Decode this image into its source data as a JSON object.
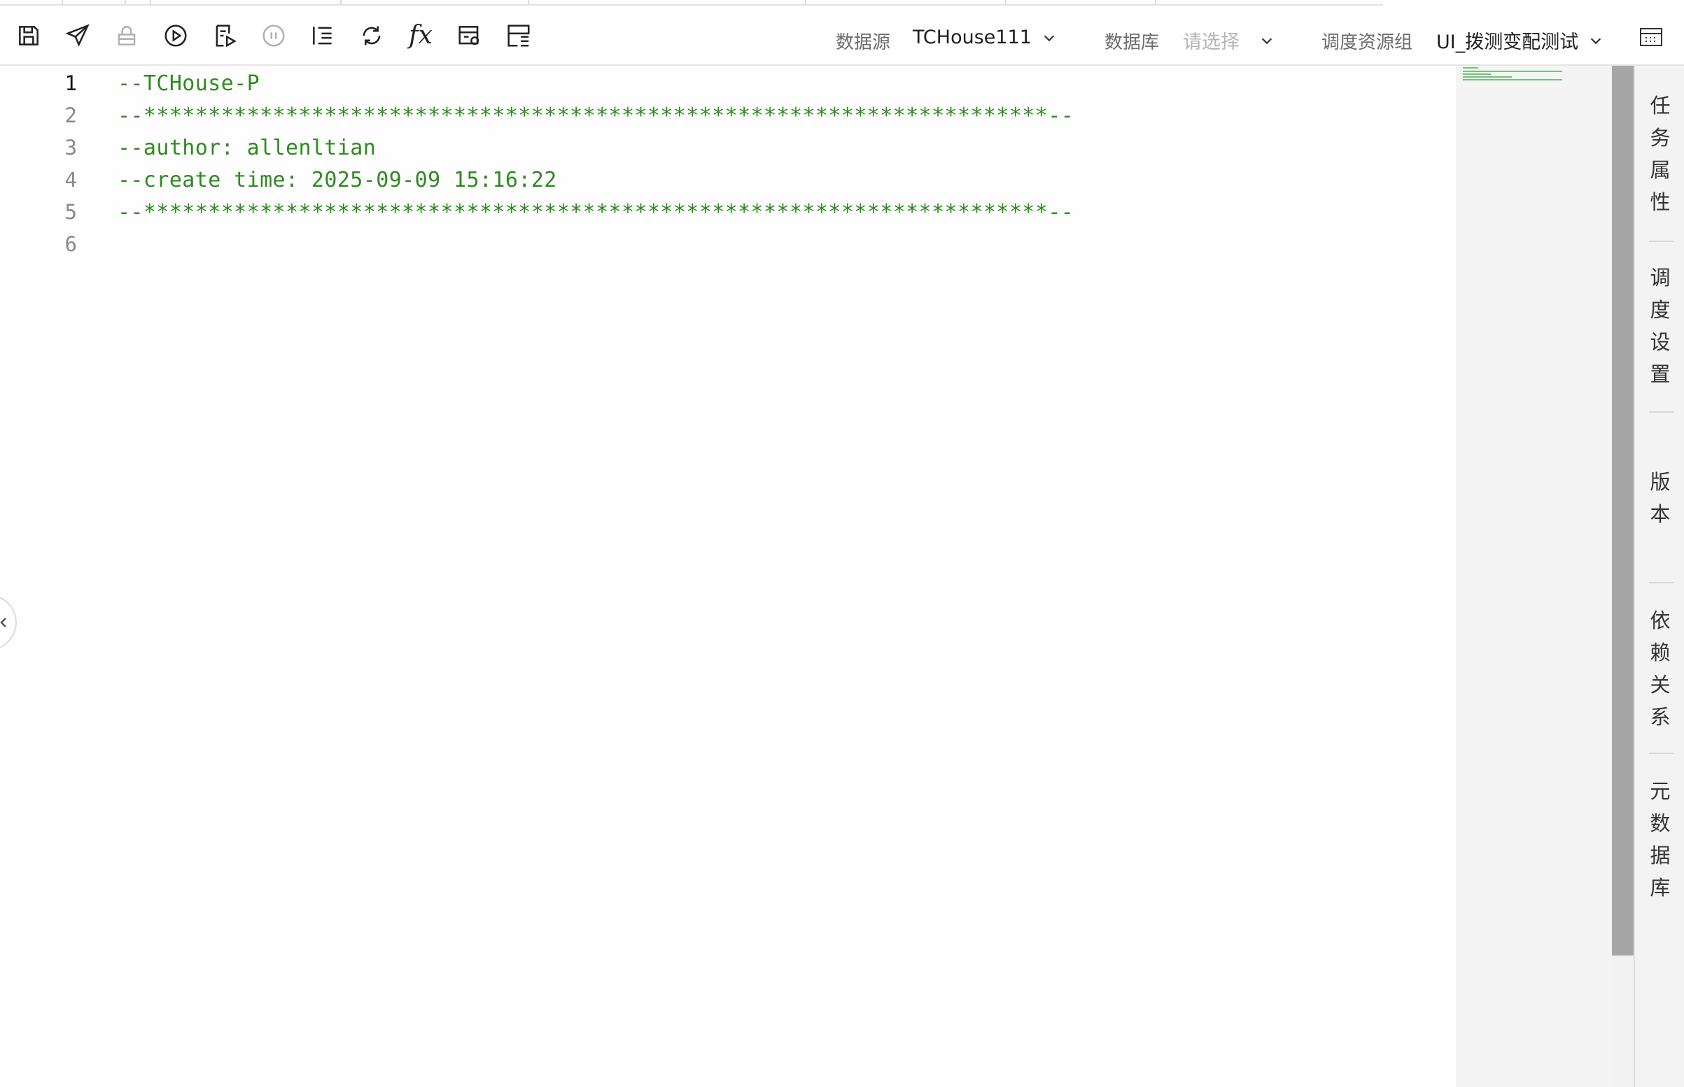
{
  "toolbar": {
    "icons": [
      "save-icon",
      "submit-icon",
      "lock-icon",
      "run-icon",
      "run-selected-icon",
      "stop-icon",
      "format-icon",
      "refresh-icon",
      "function-icon",
      "params-icon",
      "table-icon"
    ],
    "datasource_label": "数据源",
    "datasource_value": "TCHouse111",
    "database_label": "数据库",
    "database_placeholder": "请选择",
    "resource_group_label": "调度资源组",
    "resource_group_value": "UI_拨测变配测试"
  },
  "editor": {
    "active_line": 1,
    "lines": [
      {
        "number": "1",
        "text": "--TCHouse-P"
      },
      {
        "number": "2",
        "text": "--**********************************************************************--"
      },
      {
        "number": "3",
        "text": "--author: allenltian"
      },
      {
        "number": "4",
        "text": "--create time: 2025-09-09 15:16:22"
      },
      {
        "number": "5",
        "text": "--**********************************************************************--"
      },
      {
        "number": "6",
        "text": ""
      }
    ],
    "code_color": "#2e8b1f"
  },
  "right_panel": {
    "items": [
      {
        "label": "任务属性",
        "chars": [
          "任",
          "务",
          "属",
          "性"
        ]
      },
      {
        "label": "调度设置",
        "chars": [
          "调",
          "度",
          "设",
          "置"
        ]
      },
      {
        "label": "版本",
        "chars": [
          "版",
          "本"
        ]
      },
      {
        "label": "依赖关系",
        "chars": [
          "依",
          "赖",
          "关",
          "系"
        ]
      },
      {
        "label": "元数据库",
        "chars": [
          "元",
          "数",
          "据",
          "库"
        ]
      }
    ]
  }
}
